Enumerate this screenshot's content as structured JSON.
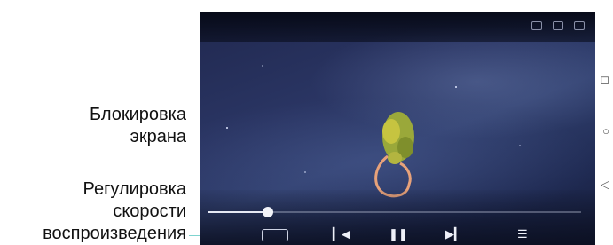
{
  "callouts": {
    "screen_lock": {
      "line1": "Блокировка",
      "line2": "экрана"
    },
    "playback_speed": {
      "line1": "Регулировка",
      "line2": "скорости",
      "line3": "воспроизведения"
    }
  },
  "player": {
    "title": "",
    "time": "",
    "elapsed": "",
    "total": "",
    "speed": "",
    "progress": 0.16
  },
  "colors": {
    "leader": "#7fd4cf",
    "controls": "#eef0f8"
  },
  "icons": {
    "prev": "skip-previous-icon",
    "pause": "pause-icon",
    "next": "skip-next-icon",
    "playlist": "playlist-icon"
  }
}
